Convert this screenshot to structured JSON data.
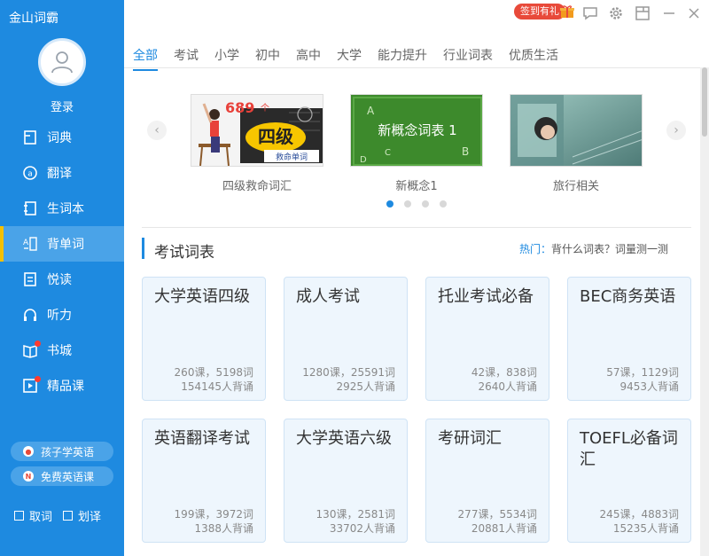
{
  "app": {
    "title": "金山词霸",
    "login": "登录"
  },
  "nav": [
    {
      "label": "词典",
      "icon": "dictionary-icon"
    },
    {
      "label": "翻译",
      "icon": "translate-icon"
    },
    {
      "label": "生词本",
      "icon": "notebook-icon"
    },
    {
      "label": "背单词",
      "icon": "flashcard-icon",
      "active": true
    },
    {
      "label": "悦读",
      "icon": "reading-icon"
    },
    {
      "label": "听力",
      "icon": "headphones-icon"
    },
    {
      "label": "书城",
      "icon": "bookstore-icon",
      "badge": true
    },
    {
      "label": "精品课",
      "icon": "course-icon",
      "badge": true
    }
  ],
  "promos": {
    "kids": "孩子学英语",
    "free": "免费英语课"
  },
  "options": {
    "capture": "取词",
    "select_translate": "划译"
  },
  "topbar": {
    "signin": "签到有礼"
  },
  "tabs": [
    "全部",
    "考试",
    "小学",
    "初中",
    "高中",
    "大学",
    "能力提升",
    "行业词表",
    "优质生活"
  ],
  "carousel": {
    "slides": [
      {
        "caption": "四级救命词汇",
        "img_num": "689",
        "img_unit": "个",
        "img_text": "四级",
        "img_sub": "救命单词"
      },
      {
        "caption": "新概念1",
        "img_text": "新概念词表 1"
      },
      {
        "caption": "旅行相关"
      }
    ],
    "page_count": 4,
    "active_page": 1
  },
  "section": {
    "title": "考试词表",
    "hot_label": "热门：",
    "hot_links": "背什么词表？词量测一测"
  },
  "cards": [
    {
      "title": "大学英语四级",
      "line1": "260课，5198词",
      "line2": "154145人背诵"
    },
    {
      "title": "成人考试",
      "line1": "1280课，25591词",
      "line2": "2925人背诵"
    },
    {
      "title": "托业考试必备",
      "line1": "42课，838词",
      "line2": "2640人背诵"
    },
    {
      "title": "BEC商务英语",
      "line1": "57课，1129词",
      "line2": "9453人背诵"
    },
    {
      "title": "英语翻译考试",
      "line1": "199课，3972词",
      "line2": "1388人背诵"
    },
    {
      "title": "大学英语六级",
      "line1": "130课，2581词",
      "line2": "33702人背诵"
    },
    {
      "title": "考研词汇",
      "line1": "277课，5534词",
      "line2": "20881人背诵"
    },
    {
      "title": "TOEFL必备词汇",
      "line1": "245课，4883词",
      "line2": "15235人背诵"
    }
  ],
  "colors": {
    "accent": "#1e8ae0",
    "sidebar": "#1e8ae0",
    "active_marker": "#f5c000",
    "badge": "#e84a3a"
  }
}
